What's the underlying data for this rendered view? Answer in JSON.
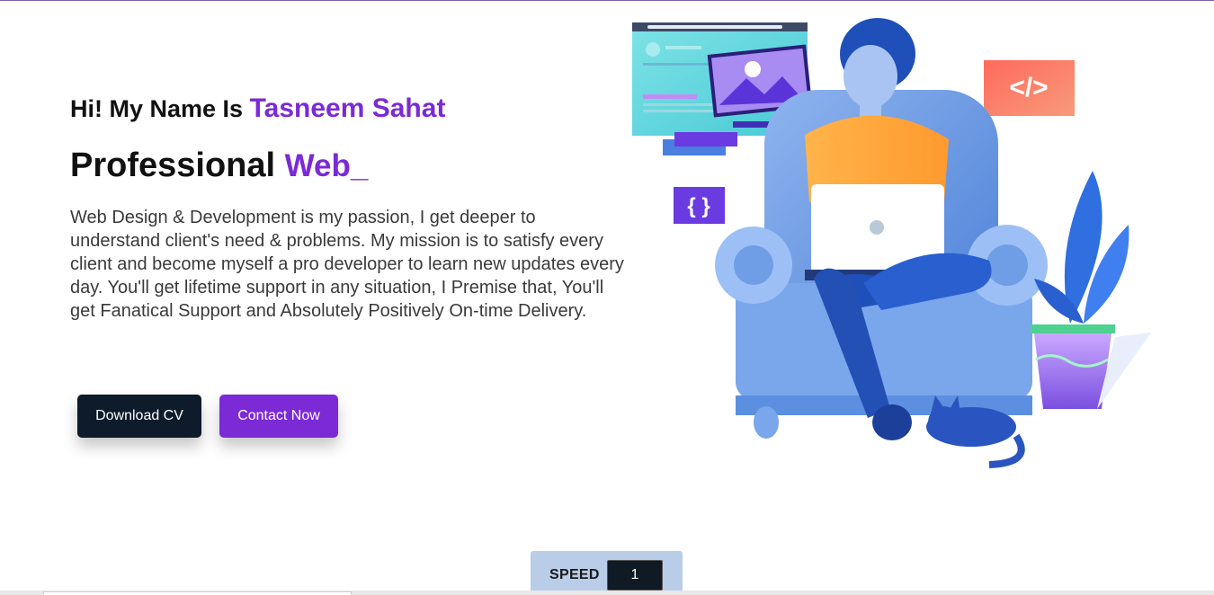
{
  "hero": {
    "greeting_prefix": "Hi! My Name Is ",
    "name": "Tasneem Sahat",
    "headline_prefix": "Professional ",
    "headline_typed": "Web",
    "headline_cursor": "_",
    "intro": "Web Design & Development is my passion, I get deeper to understand client's need & problems. My mission is to satisfy every client and become myself a pro developer to learn new updates every day. You'll get lifetime support in any situation, I Premise that, You'll get Fanatical Support and Absolutely Positively On-time Delivery.",
    "download_label": "Download CV",
    "contact_label": "Contact Now"
  },
  "illustration": {
    "code_tag": "</>",
    "braces": "{ }"
  },
  "speed": {
    "label": "SPEED",
    "value": "1"
  },
  "colors": {
    "accent": "#7b2ad6",
    "dark": "#0d1b2a",
    "speed_panel": "#b9cde9"
  }
}
